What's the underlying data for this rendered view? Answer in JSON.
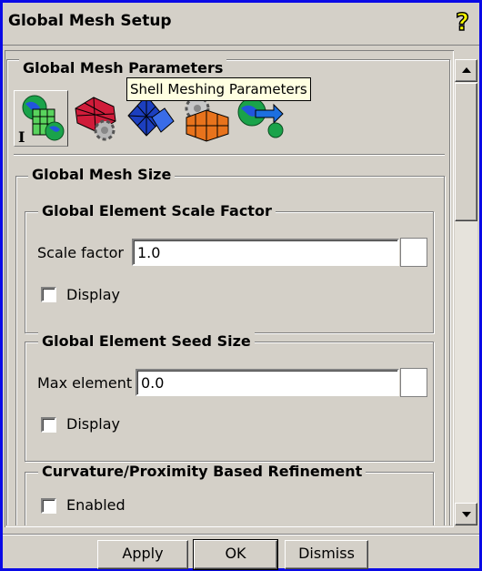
{
  "window": {
    "title": "Global Mesh Setup",
    "help_icon": "question-mark-help-icon"
  },
  "panel": {
    "section_title": "Global Mesh Parameters",
    "icon_tabs": [
      {
        "icon": "globe-mesh-icon",
        "selected": true
      },
      {
        "icon": "shell-mesh-gear-icon",
        "selected": false
      },
      {
        "icon": "tetra-mesh-icon",
        "selected": false
      },
      {
        "icon": "prism-mesh-gear-icon",
        "selected": false
      },
      {
        "icon": "globe-arrow-icon",
        "selected": false
      }
    ],
    "tooltip": "Shell Meshing Parameters",
    "mesh_size": {
      "title": "Global Mesh Size",
      "scale_factor": {
        "title": "Global Element Scale Factor",
        "label": "Scale factor",
        "value": "1.0",
        "display_label": "Display"
      },
      "seed_size": {
        "title": "Global Element Seed Size",
        "label": "Max element",
        "value": "0.0",
        "display_label": "Display"
      },
      "refinement": {
        "title": "Curvature/Proximity Based Refinement",
        "enabled_label": "Enabled"
      }
    }
  },
  "buttons": {
    "apply": "Apply",
    "ok": "OK",
    "dismiss": "Dismiss"
  },
  "colors": {
    "window_border": "#0a0ae6",
    "tooltip_bg": "#ffffe1",
    "face": "#d4d0c8"
  }
}
